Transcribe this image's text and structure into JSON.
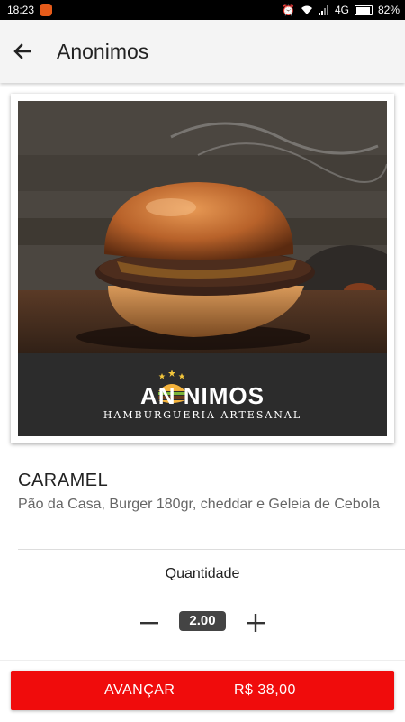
{
  "status_bar": {
    "time": "18:23",
    "network": "4G",
    "battery": "82%",
    "battery_level": 0.82
  },
  "app_bar": {
    "title": "Anonimos",
    "back_icon": "arrow-left-icon"
  },
  "product_image": {
    "brand_name": "AN  NIMOS",
    "brand_subtitle": "HAMBURGUERIA ARTESANAL",
    "logo_icon": "burger-logo-icon"
  },
  "product": {
    "name": "CARAMEL",
    "description": "Pão da Casa, Burger 180gr, cheddar e Geleia de Cebola"
  },
  "quantity": {
    "label": "Quantidade",
    "value": "2.00",
    "minus_icon": "minus-icon",
    "plus_icon": "plus-icon"
  },
  "checkout": {
    "button_label": "AVANÇAR",
    "price": "R$ 38,00",
    "accent_color": "#f00c0c"
  }
}
